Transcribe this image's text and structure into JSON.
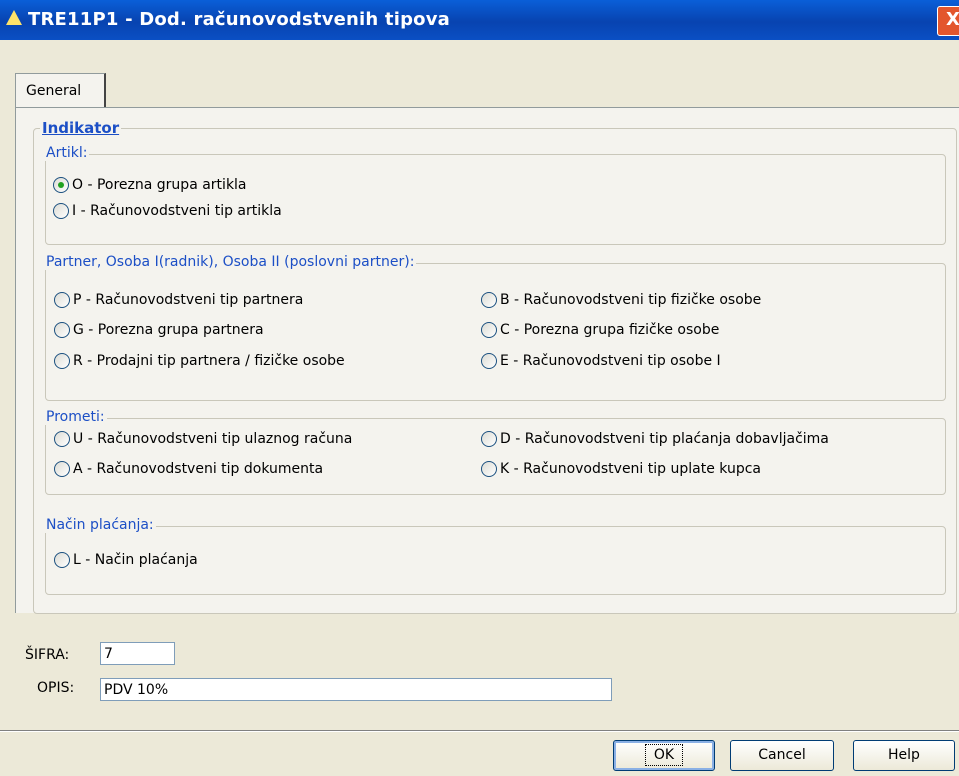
{
  "window": {
    "title": "TRE11P1 - Dod. računovodstvenih tipova",
    "close_label": "X"
  },
  "tabs": [
    {
      "label": "General"
    }
  ],
  "indikator": {
    "legend": "Indikator",
    "artikl": {
      "legend": "Artikl:",
      "options": [
        {
          "label": "O - Porezna grupa artikla",
          "selected": true
        },
        {
          "label": "I - Računovodstveni tip artikla",
          "selected": false
        }
      ]
    },
    "partner": {
      "legend": "Partner, Osoba I(radnik), Osoba II (poslovni partner):",
      "options": [
        {
          "label": "P - Računovodstveni tip partnera",
          "selected": false
        },
        {
          "label": "B - Računovodstveni tip fizičke osobe",
          "selected": false
        },
        {
          "label": "G - Porezna grupa partnera",
          "selected": false
        },
        {
          "label": "C - Porezna grupa fizičke osobe",
          "selected": false
        },
        {
          "label": "R - Prodajni tip partnera / fizičke osobe",
          "selected": false
        },
        {
          "label": "E - Računovodstveni tip osobe I",
          "selected": false
        }
      ]
    },
    "prometi": {
      "legend": "Prometi:",
      "options": [
        {
          "label": "U - Računovodstveni tip ulaznog računa",
          "selected": false
        },
        {
          "label": "D - Računovodstveni tip plaćanja dobavljačima",
          "selected": false
        },
        {
          "label": "A - Računovodstveni tip dokumenta",
          "selected": false
        },
        {
          "label": "K - Računovodstveni tip uplate kupca",
          "selected": false
        }
      ]
    },
    "nacin": {
      "legend": "Način plaćanja:",
      "options": [
        {
          "label": "L - Način plaćanja",
          "selected": false
        }
      ]
    }
  },
  "fields": {
    "sifra": {
      "label": "ŠIFRA:",
      "value": "7"
    },
    "opis": {
      "label": "OPIS:",
      "value": "PDV 10%"
    }
  },
  "buttons": {
    "ok": "OK",
    "cancel": "Cancel",
    "help": "Help"
  }
}
